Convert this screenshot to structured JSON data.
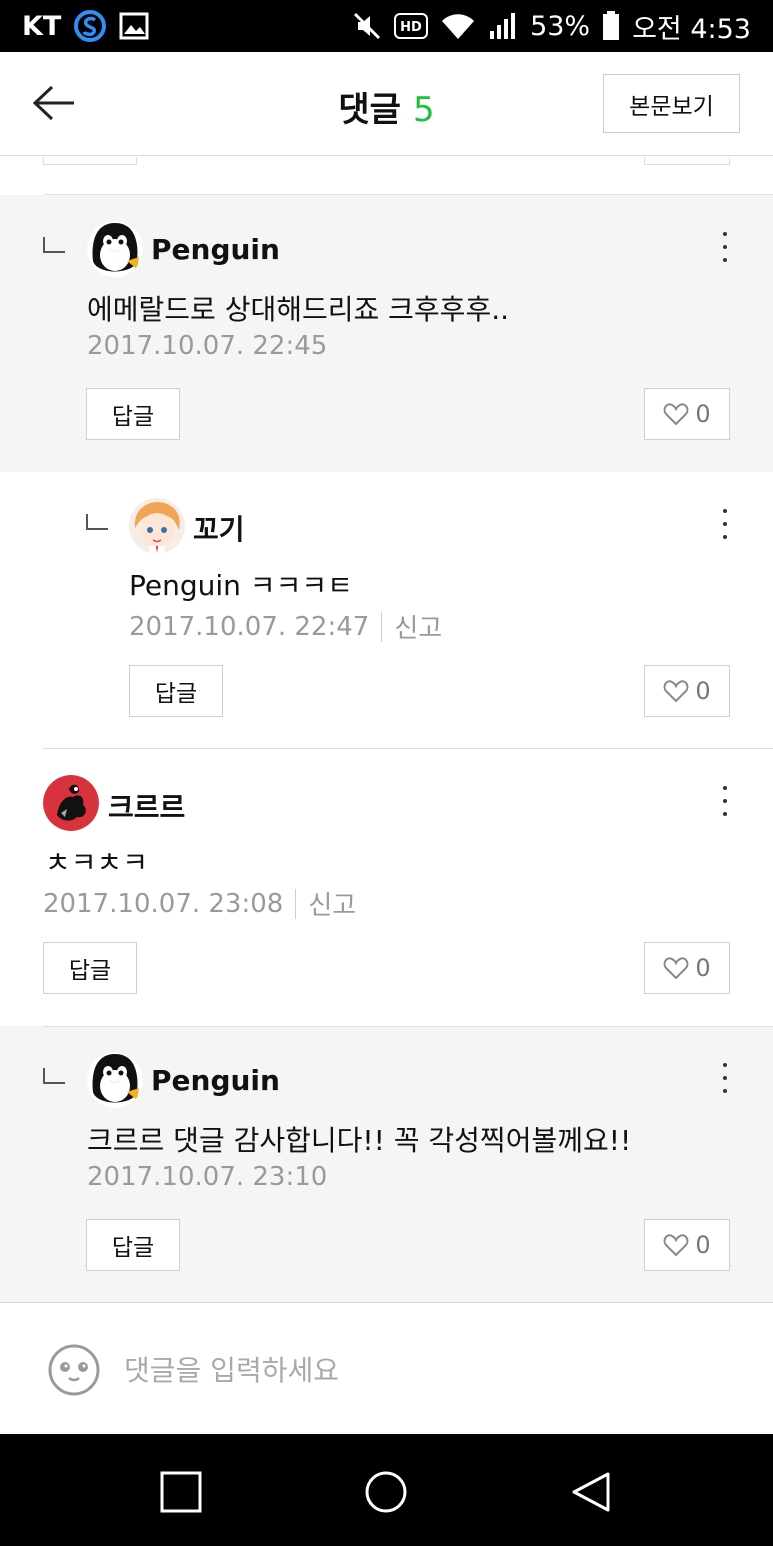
{
  "status_bar": {
    "carrier": "KT",
    "battery": "53%",
    "time": "오전 4:53",
    "icons": [
      "samsung-s-icon",
      "gallery-icon",
      "mute-icon",
      "hd-icon",
      "wifi-icon",
      "signal-icon",
      "battery-icon"
    ]
  },
  "header": {
    "title": "댓글",
    "count": "5",
    "view_post_label": "본문보기",
    "accent_color": "#20c040"
  },
  "comments": [
    {
      "author": "Penguin",
      "text": "에메랄드로 상대해드리죠 크후후후..",
      "date": "2017.10.07. 22:45",
      "report": "",
      "reply_label": "답글",
      "likes": "0",
      "avatar": "penguin-avatar"
    },
    {
      "author": "꼬기",
      "text": "Penguin ㅋㅋㅋㅌ",
      "date": "2017.10.07. 22:47",
      "report": "신고",
      "reply_label": "답글",
      "likes": "0",
      "avatar": "anime-girl-avatar"
    },
    {
      "author": "크르르",
      "text": "ㅊㅋㅊㅋ",
      "date": "2017.10.07. 23:08",
      "report": "신고",
      "reply_label": "답글",
      "likes": "0",
      "avatar": "red-dragon-avatar"
    },
    {
      "author": "Penguin",
      "text": "크르르 댓글 감사합니다!! 꼭 각성찍어볼께요!!",
      "date": "2017.10.07. 23:10",
      "report": "",
      "reply_label": "답글",
      "likes": "0",
      "avatar": "penguin-avatar"
    }
  ],
  "input": {
    "placeholder": "댓글을 입력하세요"
  },
  "nav_bar": {
    "buttons": [
      "recent-apps-icon",
      "home-icon",
      "back-icon"
    ]
  }
}
